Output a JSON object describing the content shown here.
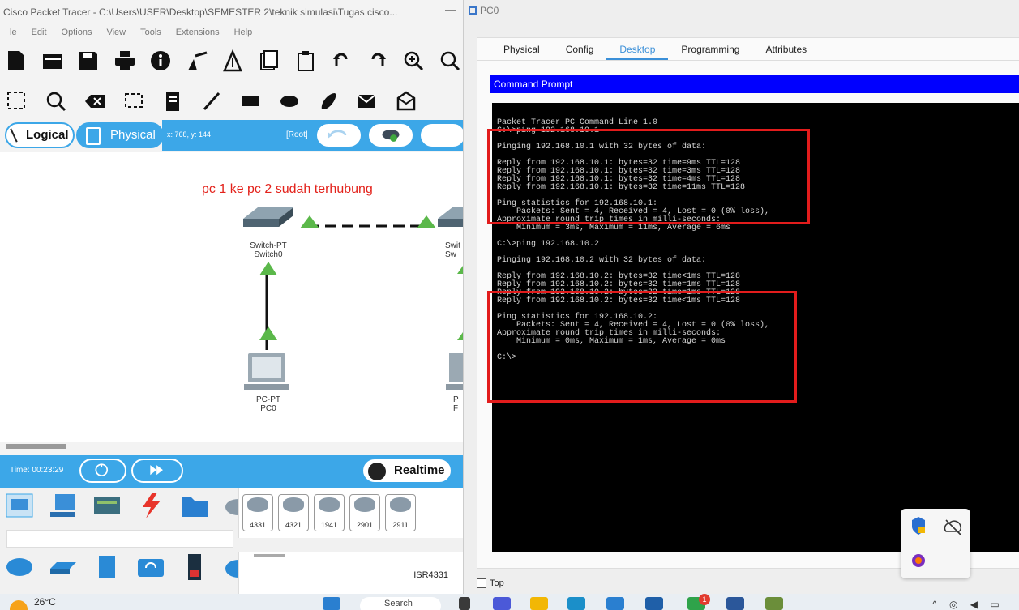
{
  "pt": {
    "title": "Cisco Packet Tracer - C:\\Users\\USER\\Desktop\\SEMESTER 2\\teknik simulasi\\Tugas cisco...",
    "menu": [
      "le",
      "Edit",
      "Options",
      "View",
      "Tools",
      "Extensions",
      "Help"
    ],
    "mode": {
      "logical": "Logical",
      "physical": "Physical",
      "coords": "x: 768, y: 144",
      "root": "[Root]"
    },
    "workspace": {
      "note": "pc 1 ke pc 2 sudah terhubung",
      "switch0_type": "Switch-PT",
      "switch0_name": "Switch0",
      "switch1_type": "Swit",
      "switch1_name": "Sw",
      "pc0_type": "PC-PT",
      "pc0_name": "PC0",
      "pc1_type": "P",
      "pc1_name": "F"
    },
    "time": {
      "label": "Time: 00:23:29",
      "realtime": "Realtime"
    },
    "routers": [
      "4331",
      "4321",
      "1941",
      "2901",
      "2911"
    ],
    "selected_model": "ISR4331"
  },
  "pc0": {
    "title": "PC0",
    "tabs": [
      "Physical",
      "Config",
      "Desktop",
      "Programming",
      "Attributes"
    ],
    "active_tab": "Desktop",
    "cmd_header": "Command Prompt",
    "cmd_lines": [
      "Packet Tracer PC Command Line 1.0",
      "C:\\>ping 192.168.10.1",
      "",
      "Pinging 192.168.10.1 with 32 bytes of data:",
      "",
      "Reply from 192.168.10.1: bytes=32 time=9ms TTL=128",
      "Reply from 192.168.10.1: bytes=32 time=3ms TTL=128",
      "Reply from 192.168.10.1: bytes=32 time=4ms TTL=128",
      "Reply from 192.168.10.1: bytes=32 time=11ms TTL=128",
      "",
      "Ping statistics for 192.168.10.1:",
      "    Packets: Sent = 4, Received = 4, Lost = 0 (0% loss),",
      "Approximate round trip times in milli-seconds:",
      "    Minimum = 3ms, Maximum = 11ms, Average = 6ms",
      "",
      "C:\\>ping 192.168.10.2",
      "",
      "Pinging 192.168.10.2 with 32 bytes of data:",
      "",
      "Reply from 192.168.10.2: bytes=32 time<1ms TTL=128",
      "Reply from 192.168.10.2: bytes=32 time=1ms TTL=128",
      "Reply from 192.168.10.2: bytes=32 time=1ms TTL=128",
      "Reply from 192.168.10.2: bytes=32 time<1ms TTL=128",
      "",
      "Ping statistics for 192.168.10.2:",
      "    Packets: Sent = 4, Received = 4, Lost = 0 (0% loss),",
      "Approximate round trip times in milli-seconds:",
      "    Minimum = 0ms, Maximum = 1ms, Average = 0ms",
      "",
      "C:\\>"
    ],
    "top_checkbox": "Top"
  },
  "taskbar": {
    "weather": "26°C",
    "search": "Search",
    "badge": "1"
  },
  "colors": {
    "pt_blue": "#3ca7e8",
    "cmd_header": "#0000ff",
    "highlight_red": "#e21c1c",
    "note_red": "#e3221b"
  }
}
